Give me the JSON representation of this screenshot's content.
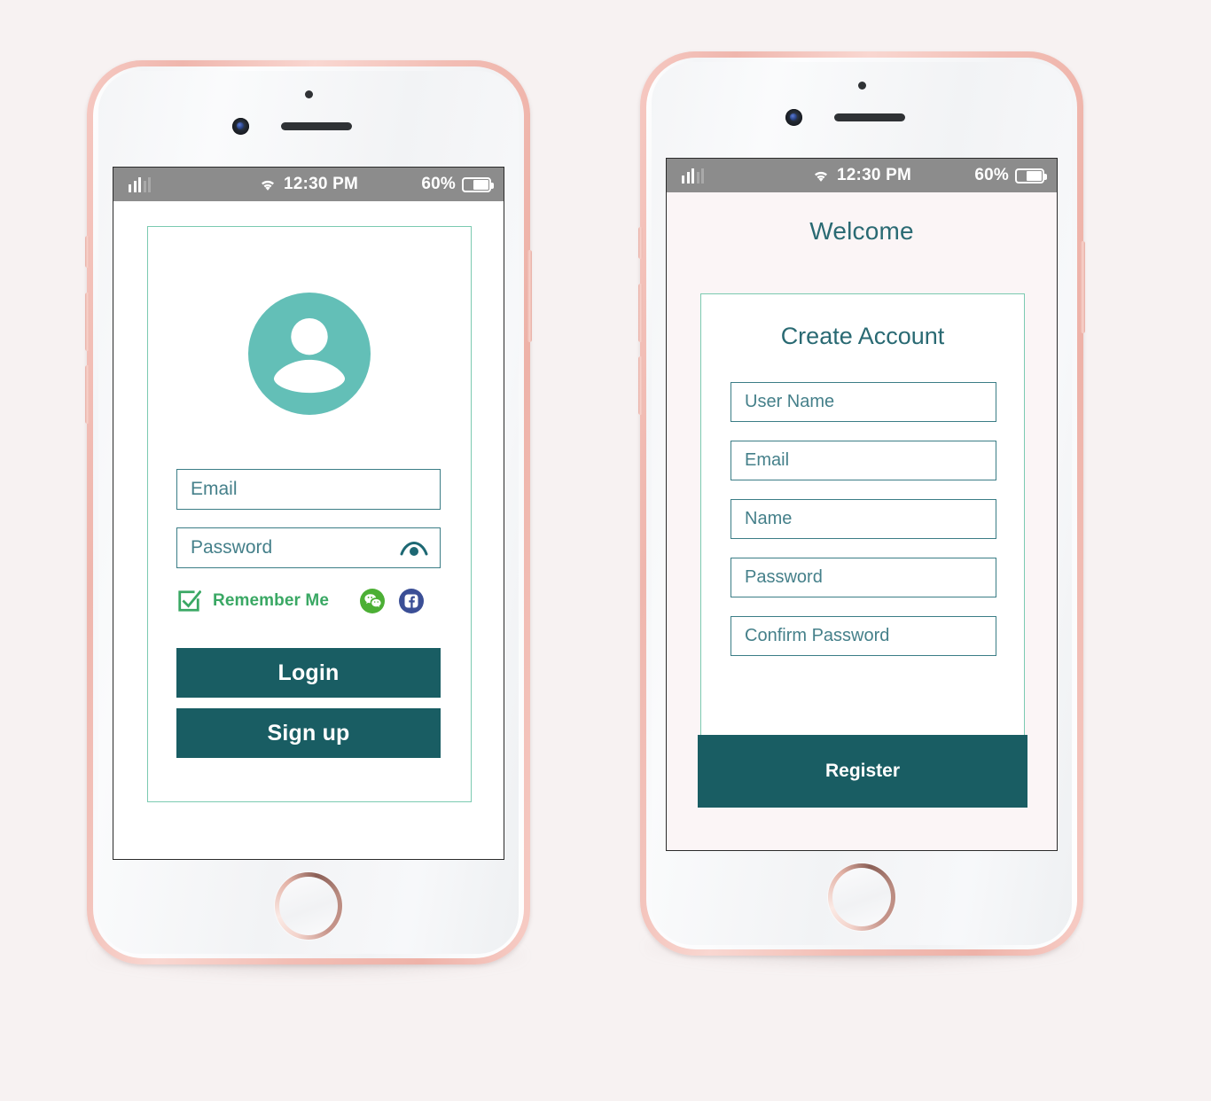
{
  "page": {
    "background_color": "#f7f2f2",
    "accent_teal": "#5fbdb4",
    "accent_dark_teal": "#195d63",
    "accent_mint_border": "#7bcab1",
    "accent_green": "#3aa864"
  },
  "status_bar": {
    "time": "12:30 PM",
    "battery_percent": "60%",
    "battery_level": 60,
    "wifi_icon": "wifi-icon",
    "signal_icon": "signal-bars-icon",
    "battery_icon": "battery-icon",
    "background_color": "#8c8c8c"
  },
  "login_screen": {
    "avatar_icon": "user-avatar-icon",
    "fields": [
      {
        "name": "email",
        "placeholder": "Email",
        "value": ""
      },
      {
        "name": "password",
        "placeholder": "Password",
        "value": "",
        "trailing_icon": "eye-icon"
      }
    ],
    "remember_me": {
      "label": "Remember Me",
      "checked": true,
      "checkbox_icon": "checkbox-checked-icon"
    },
    "social_logins": [
      {
        "name": "wechat",
        "icon": "wechat-icon",
        "color": "#4caf35"
      },
      {
        "name": "facebook",
        "icon": "facebook-icon",
        "color": "#3b5998"
      }
    ],
    "buttons": [
      {
        "name": "login",
        "label": "Login"
      },
      {
        "name": "signup",
        "label": "Sign up"
      }
    ]
  },
  "register_screen": {
    "welcome_title": "Welcome",
    "card_title": "Create Account",
    "fields": [
      {
        "name": "user-name",
        "placeholder": "User Name",
        "value": ""
      },
      {
        "name": "email",
        "placeholder": "Email",
        "value": ""
      },
      {
        "name": "name",
        "placeholder": "Name",
        "value": ""
      },
      {
        "name": "password",
        "placeholder": "Password",
        "value": ""
      },
      {
        "name": "confirm-password",
        "placeholder": "Confirm Password",
        "value": ""
      }
    ],
    "register_button": {
      "name": "register",
      "label": "Register"
    }
  },
  "device": {
    "hardware_icons": [
      "front-camera-icon",
      "proximity-sensor-icon",
      "earpiece-speaker-icon",
      "home-button-icon",
      "volume-up-button",
      "volume-down-button",
      "silent-switch",
      "power-button"
    ]
  }
}
